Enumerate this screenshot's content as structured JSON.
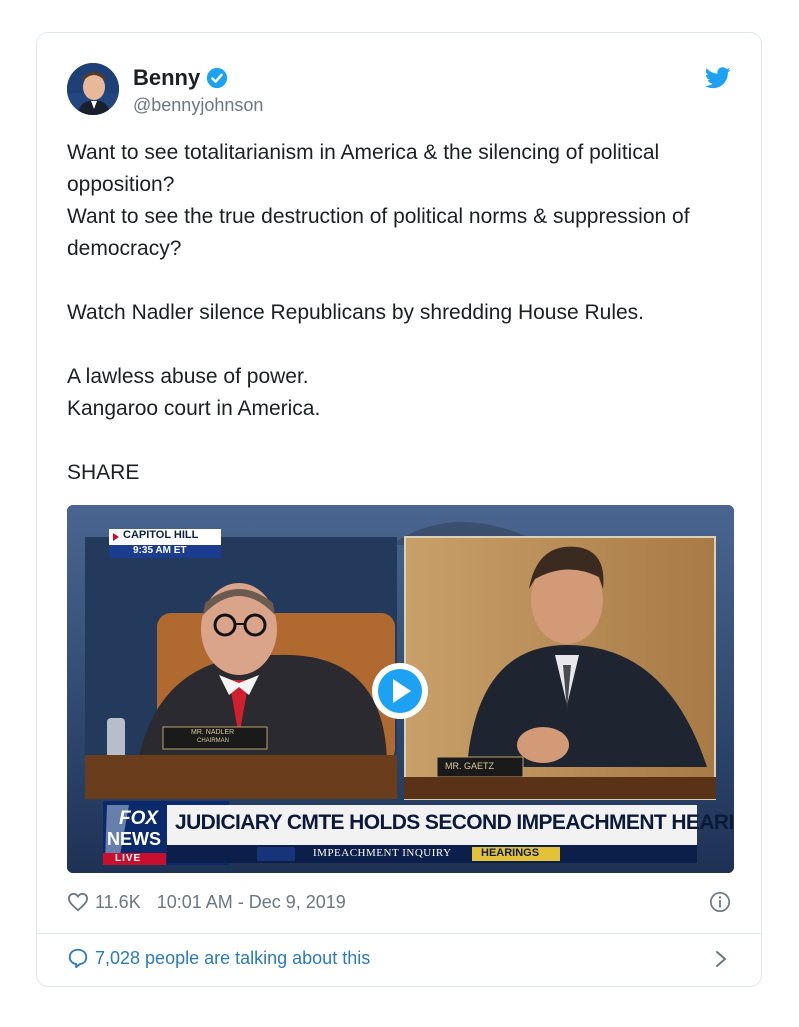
{
  "author": {
    "name": "Benny",
    "handle": "@bennyjohnson"
  },
  "tweet": {
    "lines": [
      "Want to see totalitarianism in America & the silencing of political opposition?",
      "Want to see the true destruction of political norms & suppression of democracy?",
      "Watch Nadler silence Republicans by shredding House Rules.",
      "A lawless abuse of power.",
      "Kangaroo court in America.",
      "SHARE"
    ]
  },
  "video": {
    "location": "CAPITOL HILL",
    "time": "9:35 AM ET",
    "nameplate_left": "MR. NADLER",
    "nameplate_left_sub": "CHAIRMAN",
    "nameplate_right": "MR. GAETZ",
    "network_line1": "FOX",
    "network_line2": "NEWS",
    "live": "LIVE",
    "headline": "JUDICIARY CMTE HOLDS SECOND IMPEACHMENT HEARING",
    "ticker": "IMPEACHMENT INQUIRY",
    "ticker_tag": "HEARINGS"
  },
  "meta": {
    "likes": "11.6K",
    "timestamp": "10:01 AM - Dec 9, 2019"
  },
  "footer": {
    "talking": "7,028 people are talking about this"
  },
  "colors": {
    "link": "#2b7bb9",
    "verified": "#1da1f2",
    "muted": "#697882",
    "fox_red": "#c8102e"
  }
}
